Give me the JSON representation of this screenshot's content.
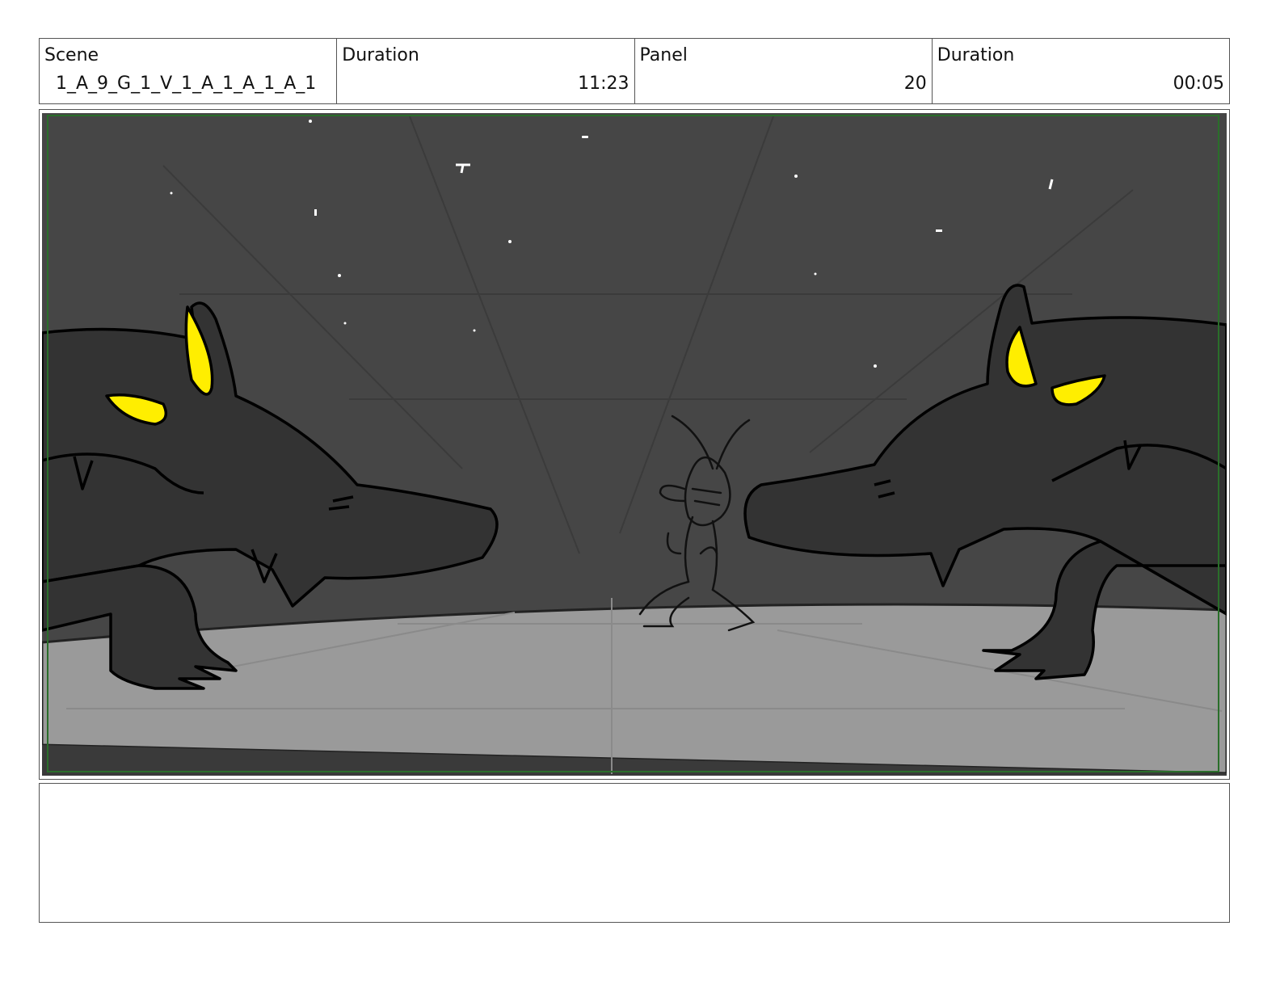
{
  "header": {
    "scene_label": "Scene",
    "scene_value": "1_A_9_G_1_V_1_A_1_A_1_A_1",
    "scene_duration_label": "Duration",
    "scene_duration_value": "11:23",
    "panel_label": "Panel",
    "panel_value": "20",
    "panel_duration_label": "Duration",
    "panel_duration_value": "00:05"
  },
  "panel_image": {
    "description_icons": [
      "creature-left-icon",
      "creature-right-icon",
      "bug-character-icon",
      "star-icon"
    ],
    "colors": {
      "sky": "#464646",
      "floor": "#9a9a9a",
      "creature": "#333333",
      "eyes": "#ffee00",
      "frame_border": "#2a6e2a"
    }
  },
  "notes": {
    "text": ""
  }
}
